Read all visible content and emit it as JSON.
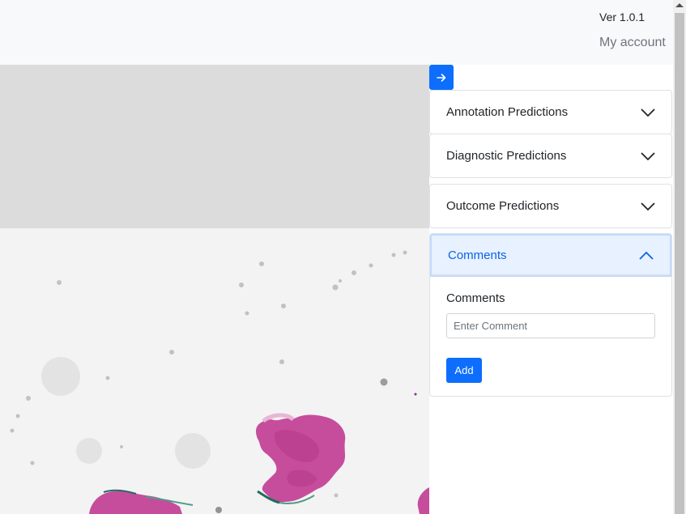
{
  "header": {
    "version": "Ver 1.0.1",
    "account_link": "My account"
  },
  "panel": {
    "sections": [
      {
        "label": "Annotation Predictions",
        "expanded": false
      },
      {
        "label": "Diagnostic Predictions",
        "expanded": false
      },
      {
        "label": "Outcome Predictions",
        "expanded": false
      },
      {
        "label": "Comments",
        "expanded": true
      }
    ],
    "comments": {
      "field_label": "Comments",
      "placeholder": "Enter Comment",
      "value": "",
      "add_label": "Add"
    }
  },
  "colors": {
    "primary": "#0d6efd",
    "active_header_bg": "#e7f1ff",
    "active_header_text": "#0c63e4",
    "tissue": "#c64d9c"
  },
  "icons": {
    "toggle": "arrow-right-icon",
    "collapsed": "chevron-down-icon",
    "expanded": "chevron-up-icon"
  }
}
